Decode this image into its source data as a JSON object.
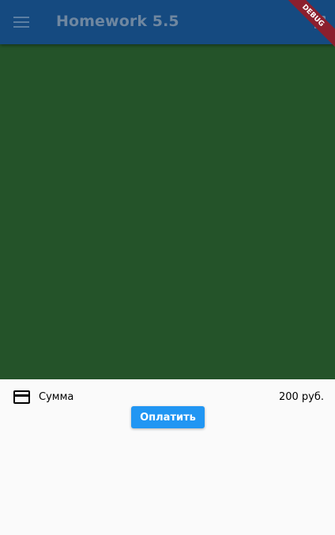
{
  "app_bar": {
    "title": "Homework 5.5",
    "menu_icon": "hamburger-menu-icon",
    "action_icon": "action-icon",
    "color": "#154a80"
  },
  "debug_banner": {
    "label": "DEBUG",
    "color": "#8b1f2e"
  },
  "content": {
    "background_color": "#245329"
  },
  "payment": {
    "card_icon": "credit-card-icon",
    "label": "Сумма",
    "amount": "200 руб.",
    "button_label": "Оплатить",
    "button_color": "#2196f3"
  }
}
